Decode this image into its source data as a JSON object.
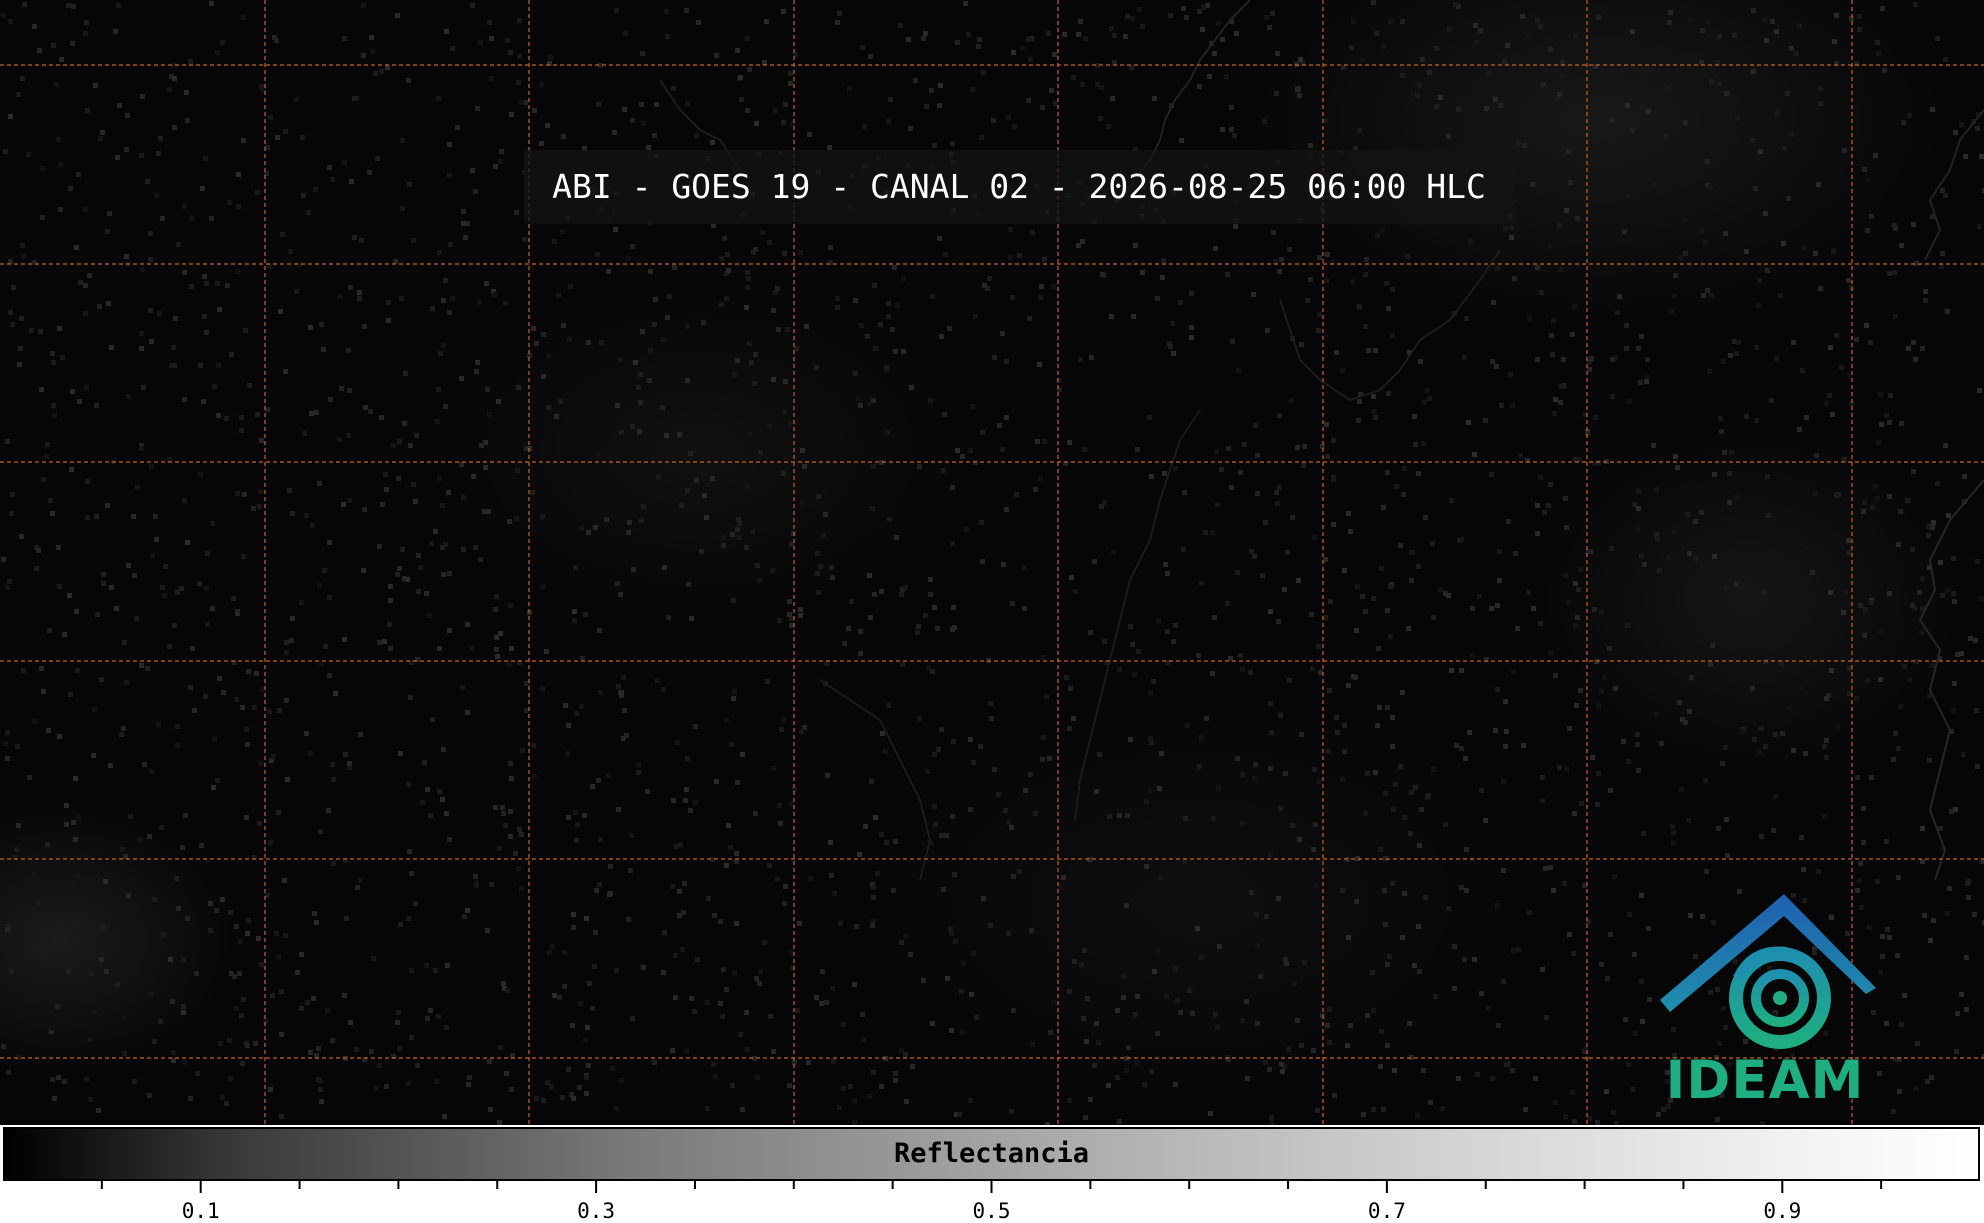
{
  "title": "ABI - GOES 19 - CANAL 02 - 2026-08-25 06:00 HLC",
  "colors": {
    "gridline": "#c0642a",
    "background": "#000000",
    "logo_blue": "#1f6fae",
    "logo_teal": "#1fae82"
  },
  "logo": {
    "text": "IDEAM",
    "icon": "ideam-logo-icon"
  },
  "colorbar": {
    "label": "Reflectancia",
    "range": [
      0.0,
      1.0
    ],
    "colormap": "greys",
    "major_ticks": [
      0.1,
      0.3,
      0.5,
      0.7,
      0.9
    ],
    "tick_labels": [
      "0.1",
      "0.3",
      "0.5",
      "0.7",
      "0.9"
    ],
    "minor_ticks": [
      0.05,
      0.15,
      0.2,
      0.25,
      0.35,
      0.4,
      0.45,
      0.55,
      0.6,
      0.65,
      0.75,
      0.8,
      0.85,
      0.95
    ]
  }
}
